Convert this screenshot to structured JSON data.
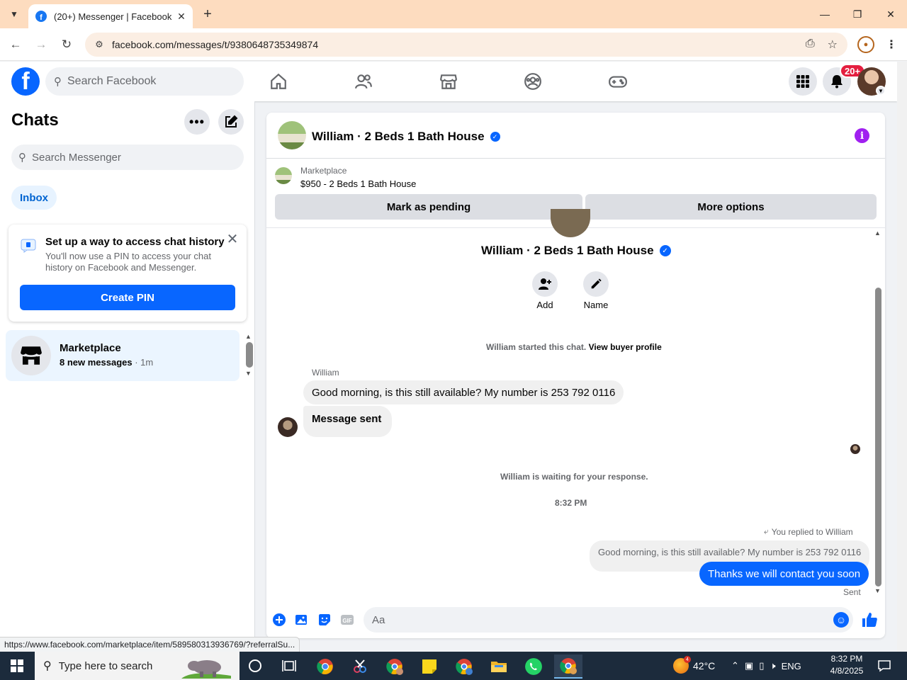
{
  "browser": {
    "tab_title": "(20+) Messenger | Facebook",
    "url": "facebook.com/messages/t/9380648735349874",
    "status_url": "https://www.facebook.com/marketplace/item/589580313936769/?referralSu..."
  },
  "fb_header": {
    "search_placeholder": "Search Facebook",
    "notification_badge": "20+"
  },
  "sidebar": {
    "title": "Chats",
    "search_placeholder": "Search Messenger",
    "inbox_label": "Inbox",
    "pin_card": {
      "title": "Set up a way to access chat history",
      "description": "You'll now use a PIN to access your chat history on Facebook and Messenger.",
      "button": "Create PIN"
    },
    "chat_item": {
      "name": "Marketplace",
      "preview": "8 new messages",
      "time": " · 1m"
    }
  },
  "conversation": {
    "title": "William · 2 Beds 1 Bath House",
    "marketplace_label": "Marketplace",
    "listing": "$950 - 2 Beds 1 Bath House",
    "mark_pending": "Mark as pending",
    "more_options": "More options",
    "intro_name": "William · 2 Beds 1 Bath House",
    "action_add": "Add",
    "action_name": "Name",
    "started_text": "William started this chat.",
    "buyer_profile_link": "View buyer profile",
    "sender_label": "William",
    "message_1": "Good morning, is this still available? My number is 253 792 0116",
    "message_2": "Message sent",
    "waiting_text": "William is waiting for your response.",
    "timestamp": "8:32 PM",
    "replied_label": "You replied to William",
    "quoted_message": "Good morning, is this still available? My number is 253 792 0116",
    "my_message": "Thanks we will contact you soon",
    "sent_status": "Sent",
    "composer_placeholder": "Aa"
  },
  "taskbar": {
    "search_placeholder": "Type here to search",
    "weather_temp": "42°C",
    "weather_badge": "4",
    "language": "ENG",
    "time": "8:32 PM",
    "date": "4/8/2025"
  },
  "colors": {
    "fb_blue": "#0866ff",
    "chrome_tab_bar": "#fddcbf",
    "taskbar": "#1c2b3c"
  }
}
